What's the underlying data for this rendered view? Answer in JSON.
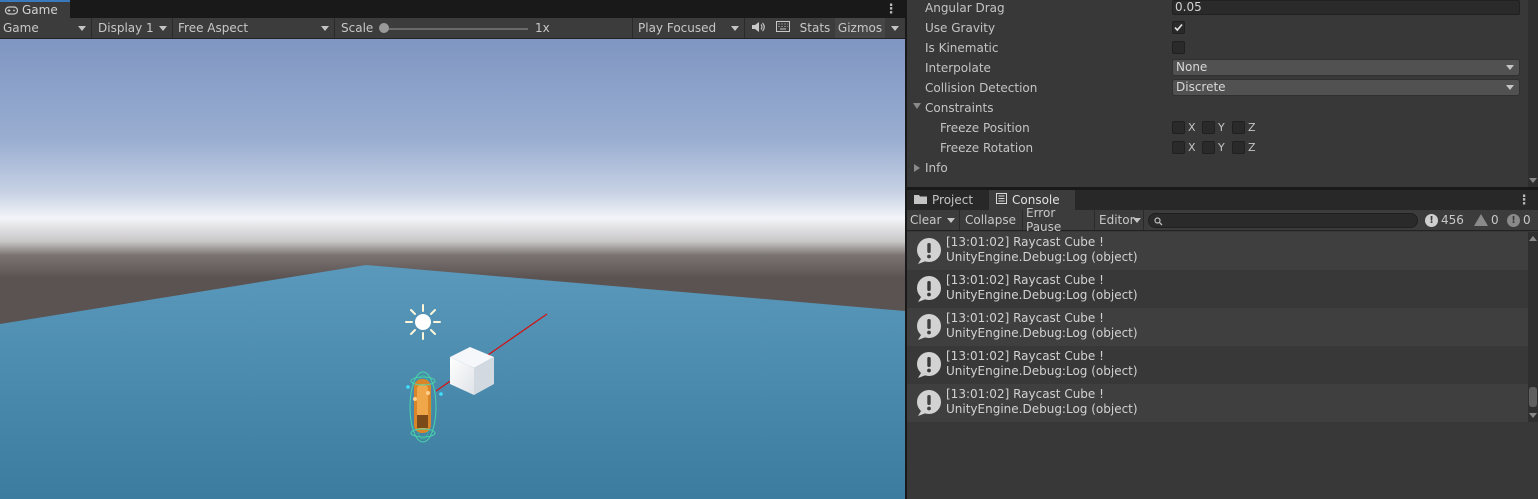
{
  "game": {
    "tab_label": "Game",
    "toolbar": {
      "view_mode": "Game",
      "display": "Display 1",
      "aspect": "Free Aspect",
      "scale_label": "Scale",
      "scale_value": "1x",
      "play_mode": "Play Focused",
      "stats_label": "Stats",
      "gizmos_label": "Gizmos"
    },
    "colors": {
      "sky_top": "#7f96c2",
      "sky_horizon": "#f2f4f8",
      "ground": "#5b5352",
      "plane": "#4a8bae",
      "ray": "#d01515"
    }
  },
  "inspector": {
    "angular_drag": {
      "label": "Angular Drag",
      "value": "0.05"
    },
    "use_gravity": {
      "label": "Use Gravity",
      "checked": true
    },
    "is_kinematic": {
      "label": "Is Kinematic",
      "checked": false
    },
    "interpolate": {
      "label": "Interpolate",
      "value": "None"
    },
    "collision_detection": {
      "label": "Collision Detection",
      "value": "Discrete"
    },
    "constraints": {
      "label": "Constraints"
    },
    "freeze_position": {
      "label": "Freeze Position",
      "x": "X",
      "y": "Y",
      "z": "Z"
    },
    "freeze_rotation": {
      "label": "Freeze Rotation",
      "x": "X",
      "y": "Y",
      "z": "Z"
    },
    "info": {
      "label": "Info"
    }
  },
  "console": {
    "tabs": [
      {
        "label": "Project"
      },
      {
        "label": "Console"
      }
    ],
    "toolbar": {
      "clear": "Clear",
      "collapse": "Collapse",
      "error_pause": "Error Pause",
      "editor": "Editor",
      "log_count": "456",
      "warning_count": "0",
      "error_count": "0"
    },
    "logs": [
      {
        "line1": "[13:01:02] Raycast Cube !",
        "line2": "UnityEngine.Debug:Log (object)"
      },
      {
        "line1": "[13:01:02] Raycast Cube !",
        "line2": "UnityEngine.Debug:Log (object)"
      },
      {
        "line1": "[13:01:02] Raycast Cube !",
        "line2": "UnityEngine.Debug:Log (object)"
      },
      {
        "line1": "[13:01:02] Raycast Cube !",
        "line2": "UnityEngine.Debug:Log (object)"
      },
      {
        "line1": "[13:01:02] Raycast Cube !",
        "line2": "UnityEngine.Debug:Log (object)"
      }
    ]
  }
}
